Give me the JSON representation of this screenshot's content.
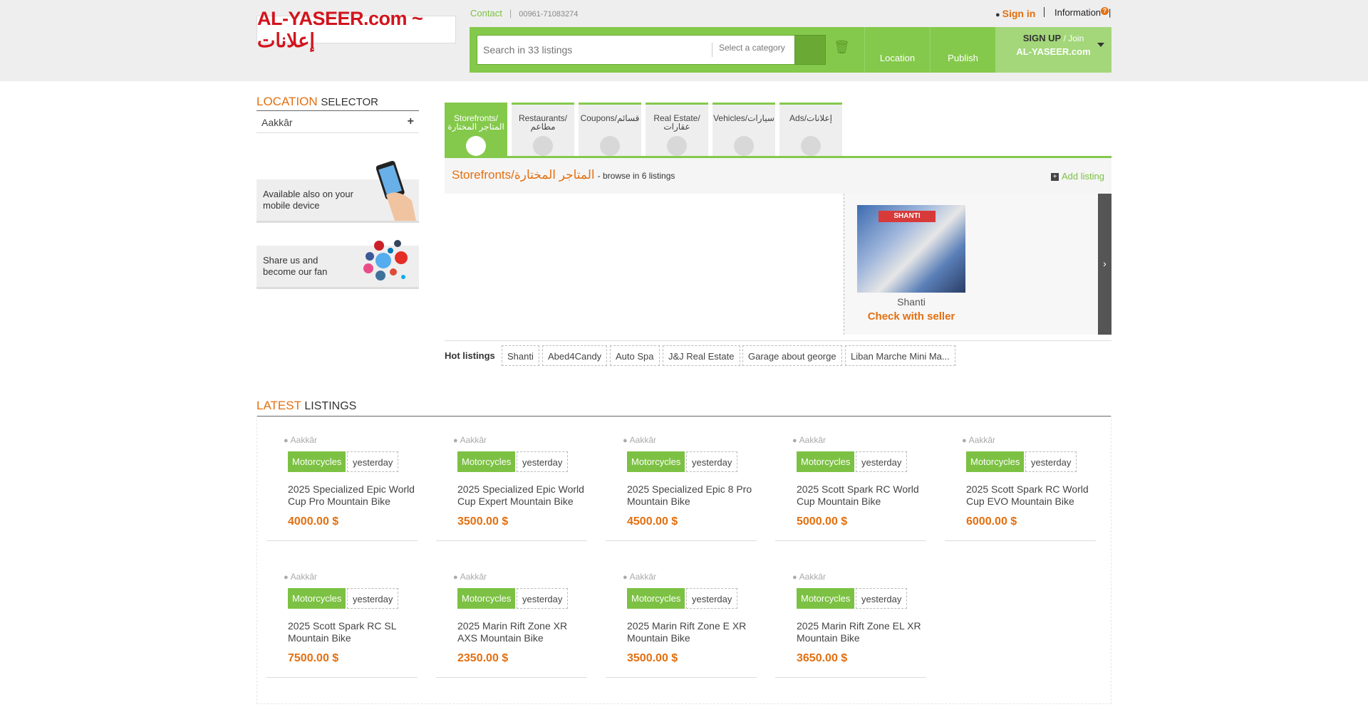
{
  "header": {
    "logo_text": "AL-YASEER.com ~ إعلانات",
    "contact_label": "Contact",
    "phone": "00961-71083274",
    "signin_label": "Sign in",
    "information_label": "Information",
    "search": {
      "placeholder": "Search in 33 listings",
      "category_label": "Select a category"
    },
    "nav": {
      "location": "Location",
      "publish": "Publish"
    },
    "signup": {
      "label": "SIGN UP",
      "join": "/ Join",
      "site": "AL-YASEER.com"
    }
  },
  "sidebar": {
    "location_title_accent": "LOCATION",
    "location_title_rest": "SELECTOR",
    "location_item": "Aakkâr",
    "mobile_promo": "Available also on your mobile device",
    "share_promo": "Share us and become our fan"
  },
  "tabs": [
    {
      "label": "Storefronts/ ﺍﻟﻤﺘﺎﺟﺮ ﺍﻟﻤﺨﺘﺎﺭﺓ",
      "active": true,
      "icon": "soccer-icon"
    },
    {
      "label": "Restaurants/ ﻣﻄﺎﻋﻢ",
      "active": false,
      "icon": "soccer-icon"
    },
    {
      "label": "Coupons/ﻗﺴﺎﺋﻢ",
      "active": false,
      "icon": "soccer-icon"
    },
    {
      "label": "Real Estate/ ﻋﻘﺎﺭﺍﺕ",
      "active": false,
      "icon": "house-icon"
    },
    {
      "label": "Vehicles/ﺳﻴﺎﺭﺍﺕ",
      "active": false,
      "icon": "car-icon"
    },
    {
      "label": "Ads/ﺇﻋﻼﻧﺎﺕ",
      "active": false,
      "icon": "soccer-icon"
    }
  ],
  "storefront": {
    "title": "Storefronts/ﺍﻟﻤﺘﺎﺟﺮ ﺍﻟﻤﺨﺘﺎﺭﺓ",
    "browse": "- browse in 6 listings",
    "add_listing": "Add listing",
    "featured_name": "Shanti",
    "featured_sign": "SHANTI",
    "featured_cta": "Check with seller"
  },
  "hot_listings": {
    "label": "Hot listings",
    "items": [
      "Shanti",
      "Abed4Candy",
      "Auto Spa",
      "J&J Real Estate",
      "Garage about george",
      "Liban Marche Mini Ma..."
    ]
  },
  "latest": {
    "title_accent": "LATEST",
    "title_rest": "LISTINGS",
    "items": [
      {
        "location": "Aakkâr",
        "category": "Motorcycles",
        "date": "yesterday",
        "title": "2025 Specialized Epic World Cup Pro Mountain Bike",
        "price": "4000.00 $"
      },
      {
        "location": "Aakkâr",
        "category": "Motorcycles",
        "date": "yesterday",
        "title": "2025 Specialized Epic World Cup Expert Mountain Bike",
        "price": "3500.00 $"
      },
      {
        "location": "Aakkâr",
        "category": "Motorcycles",
        "date": "yesterday",
        "title": "2025 Specialized Epic 8 Pro Mountain Bike",
        "price": "4500.00 $"
      },
      {
        "location": "Aakkâr",
        "category": "Motorcycles",
        "date": "yesterday",
        "title": "2025 Scott Spark RC World Cup Mountain Bike",
        "price": "5000.00 $"
      },
      {
        "location": "Aakkâr",
        "category": "Motorcycles",
        "date": "yesterday",
        "title": "2025 Scott Spark RC World Cup EVO Mountain Bike",
        "price": "6000.00 $"
      },
      {
        "location": "Aakkâr",
        "category": "Motorcycles",
        "date": "yesterday",
        "title": "2025 Scott Spark RC SL Mountain Bike",
        "price": "7500.00 $"
      },
      {
        "location": "Aakkâr",
        "category": "Motorcycles",
        "date": "yesterday",
        "title": "2025 Marin Rift Zone XR AXS Mountain Bike",
        "price": "2350.00 $"
      },
      {
        "location": "Aakkâr",
        "category": "Motorcycles",
        "date": "yesterday",
        "title": "2025 Marin Rift Zone E XR Mountain Bike",
        "price": "3500.00 $"
      },
      {
        "location": "Aakkâr",
        "category": "Motorcycles",
        "date": "yesterday",
        "title": "2025 Marin Rift Zone EL XR Mountain Bike",
        "price": "3650.00 $"
      }
    ]
  },
  "colors": {
    "accent_green": "#84c94b",
    "accent_orange": "#e36f0f"
  }
}
